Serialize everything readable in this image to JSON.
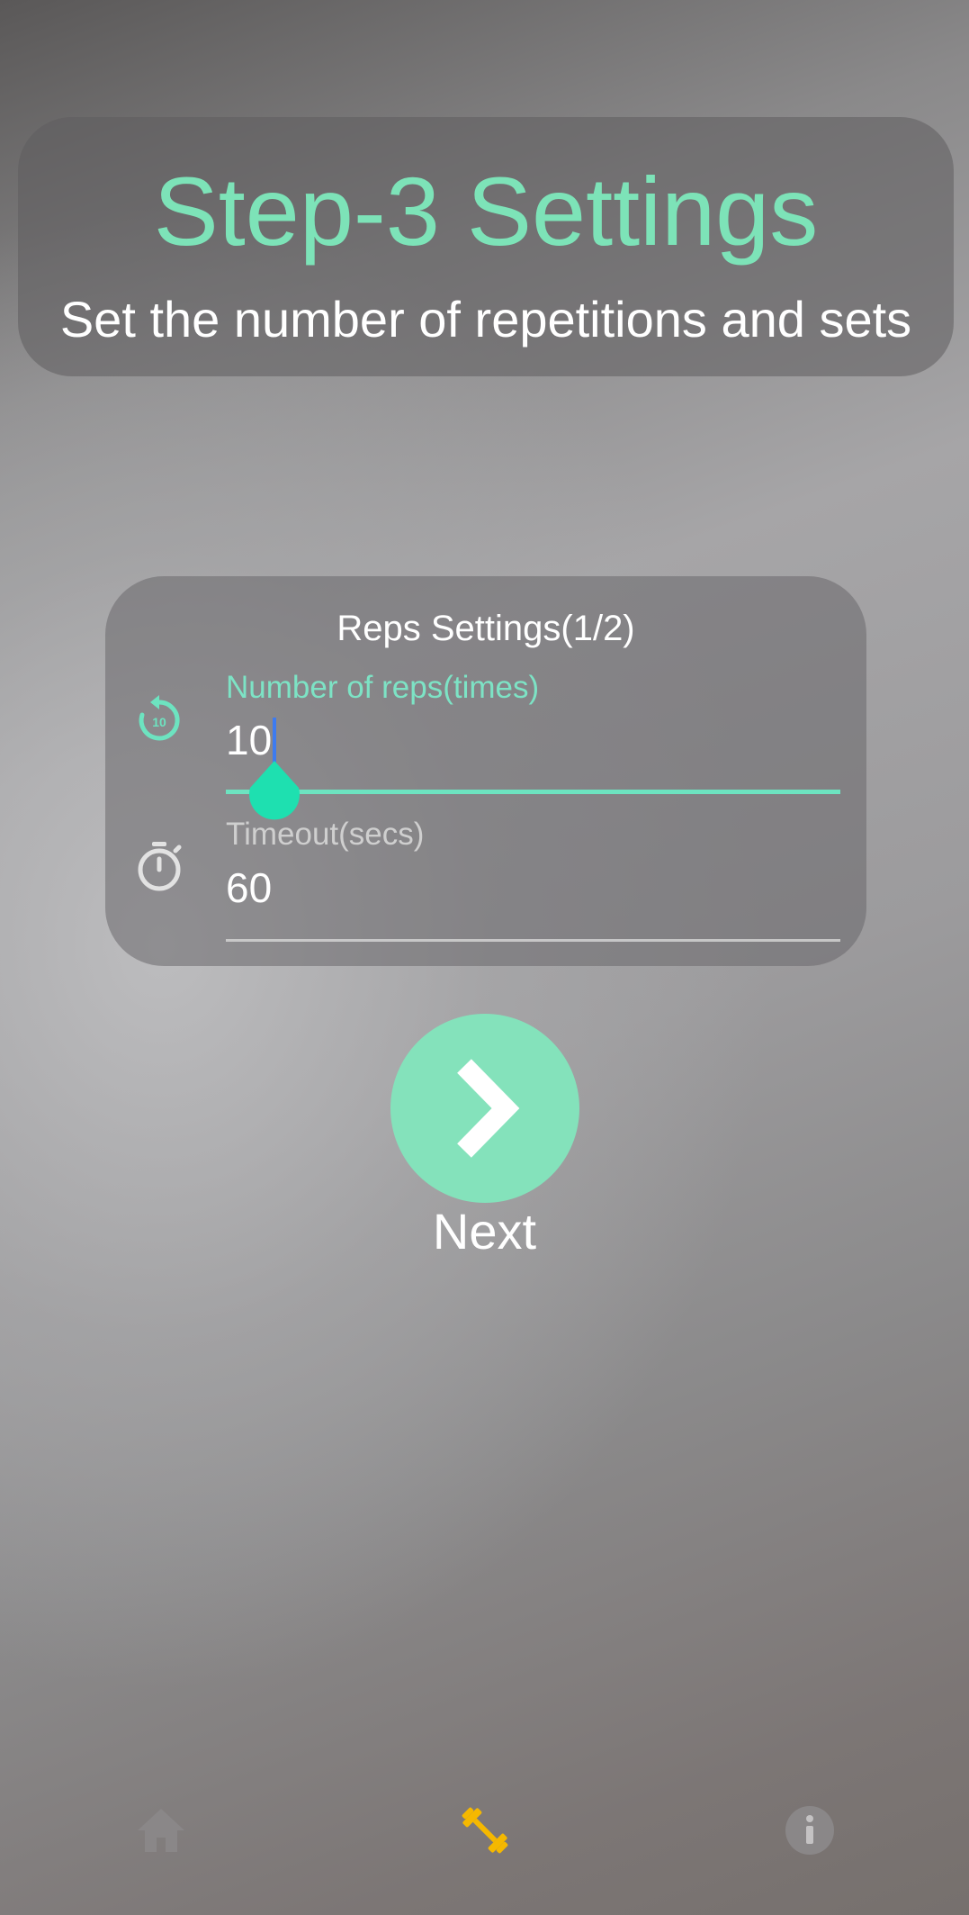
{
  "header": {
    "title": "Step-3 Settings",
    "subtitle": "Set the number of repetitions and sets"
  },
  "reps_card": {
    "title": "Reps Settings(1/2)",
    "reps_field": {
      "icon": "replay-10-icon",
      "label": "Number of reps(times)",
      "value": "10"
    },
    "timeout_field": {
      "icon": "timer-icon",
      "label": "Timeout(secs)",
      "value": "60"
    }
  },
  "next": {
    "icon": "chevron-right-icon",
    "label": "Next"
  },
  "bottom_nav": {
    "items": [
      {
        "icon": "home-icon",
        "active": false
      },
      {
        "icon": "dumbbell-icon",
        "active": true
      },
      {
        "icon": "info-icon",
        "active": false
      }
    ]
  },
  "colors": {
    "accent": "#7de3b8",
    "active_nav": "#f5b800",
    "inactive_nav": "#8a8788",
    "cursor": "#3d7bf0"
  }
}
